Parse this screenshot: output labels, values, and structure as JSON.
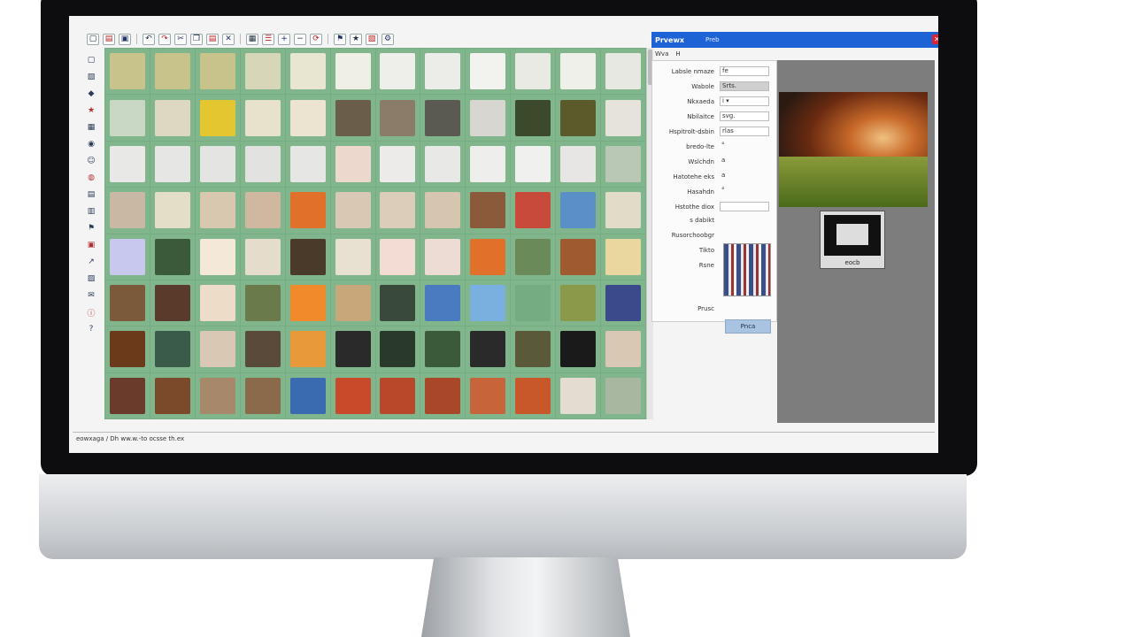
{
  "window": {
    "title": "Prvewx",
    "title_secondary": "Preb",
    "close_icon": "close-icon",
    "tabs": [
      "Wva",
      "H"
    ]
  },
  "toolbar": {
    "buttons": [
      {
        "icon": "new-icon",
        "glyph": "▢"
      },
      {
        "icon": "open-icon",
        "glyph": "▤"
      },
      {
        "icon": "save-icon",
        "glyph": "▣"
      },
      {
        "icon": "undo-icon",
        "glyph": "↶"
      },
      {
        "icon": "redo-icon",
        "glyph": "↷"
      },
      {
        "icon": "cut-icon",
        "glyph": "✂"
      },
      {
        "icon": "copy-icon",
        "glyph": "❐"
      },
      {
        "icon": "paste-icon",
        "glyph": "▤"
      },
      {
        "icon": "delete-icon",
        "glyph": "✕"
      },
      {
        "icon": "grid-icon",
        "glyph": "▦"
      },
      {
        "icon": "list-icon",
        "glyph": "☰"
      },
      {
        "icon": "zoom-in-icon",
        "glyph": "+"
      },
      {
        "icon": "zoom-out-icon",
        "glyph": "−"
      },
      {
        "icon": "rotate-icon",
        "glyph": "⟳"
      },
      {
        "icon": "flag-icon",
        "glyph": "⚑"
      },
      {
        "icon": "star-icon",
        "glyph": "★"
      },
      {
        "icon": "image-icon",
        "glyph": "▧"
      },
      {
        "icon": "settings-icon",
        "glyph": "⚙"
      }
    ]
  },
  "left_rail": {
    "icons": [
      "folder-icon",
      "image-icon",
      "tag-icon",
      "star-icon",
      "calendar-icon",
      "camera-icon",
      "person-icon",
      "map-icon",
      "album-icon",
      "trash-icon",
      "flag-icon",
      "lock-icon",
      "share-icon",
      "print-icon",
      "mail-icon",
      "info-icon",
      "help-icon"
    ]
  },
  "thumbnails": {
    "colors": [
      "#c8c38a",
      "#c8c38a",
      "#c8c38a",
      "#d8d6b8",
      "#e8e6d0",
      "#f0efe6",
      "#eeeeea",
      "#ecece8",
      "#f2f2ee",
      "#eaeae4",
      "#f0f0ea",
      "#e8e8e2",
      "#c8d8c4",
      "#ddd8c2",
      "#e3c630",
      "#e8e2cc",
      "#ece4d0",
      "#6a5e4a",
      "#8a7c68",
      "#5a5a52",
      "#d8d6d0",
      "#3a4a2a",
      "#5a5a2a",
      "#e6e4da",
      "#e8e8e6",
      "#e6e6e4",
      "#e4e4e2",
      "#e2e2e0",
      "#e6e6e4",
      "#ecd8cc",
      "#ecebea",
      "#e8e8e6",
      "#eeeeec",
      "#f0f0ee",
      "#e8e6e4",
      "#b8c8b4",
      "#c8b8a4",
      "#e4ddc8",
      "#d8c8b0",
      "#d0b8a0",
      "#e0702a",
      "#d8c8b4",
      "#dcccba",
      "#d6c6b0",
      "#8a5a3a",
      "#c84a3a",
      "#5a90c8",
      "#e0dcc8",
      "#c8c8ee",
      "#3a5a3a",
      "#f4e8d8",
      "#e6dccc",
      "#4a3a2a",
      "#e8e0d0",
      "#f2dcd4",
      "#ecdcd4",
      "#e0702a",
      "#6a8a5a",
      "#a05a30",
      "#e8d8a0",
      "#7a5a3a",
      "#5a3a2a",
      "#ecdcc8",
      "#6a7a4a",
      "#f08a2a",
      "#c8a87a",
      "#3a4a3a",
      "#4a7ac0",
      "#7ab0e0",
      "#76ac82",
      "#8a9a4a",
      "#3a4a8a",
      "#6a3a1a",
      "#3a5a4a",
      "#d8c8b4",
      "#5a4a3a",
      "#e89a3a",
      "#2a2a2a",
      "#2a3a2a",
      "#3a5a3a",
      "#2a2a2a",
      "#5a5a3a",
      "#1a1a1a",
      "#d8c8b4",
      "#6a3a2a",
      "#7a4a2a",
      "#a8886a",
      "#8a6a4a",
      "#3a6ab0",
      "#c84a2a",
      "#b8482a",
      "#a84828",
      "#c8643a",
      "#c8582a",
      "#e4dcd0",
      "#a8b8a0"
    ]
  },
  "properties": {
    "rows": [
      {
        "label": "Labsle nmaze",
        "value": "fe",
        "style": "field"
      },
      {
        "label": "Wabole",
        "value": "Srts.",
        "style": "gray"
      },
      {
        "label": "Nkxaeda",
        "value": "i ▾",
        "style": "field"
      },
      {
        "label": "Nbilaitce",
        "value": "svg.",
        "style": "field"
      },
      {
        "label": "Hspitrolt-dsbin",
        "value": "rlas",
        "style": "field"
      },
      {
        "label": "bredo-lte",
        "value": "°",
        "style": "bare"
      },
      {
        "label": "Wslchdn",
        "value": "a",
        "style": "bare"
      },
      {
        "label": "Hatotehe eks",
        "value": "a",
        "style": "bare"
      },
      {
        "label": "Hasahdn",
        "value": "°",
        "style": "bare"
      },
      {
        "label": "Hstothe diox",
        "value": "",
        "style": "field"
      },
      {
        "label": "s dabikt",
        "value": "",
        "style": "bare"
      },
      {
        "label": "Rusorchoobgr",
        "value": "",
        "style": "bare"
      },
      {
        "label": "Tikto",
        "value": "",
        "style": "bare"
      },
      {
        "label": "Rsne",
        "value": "",
        "style": "bare"
      }
    ],
    "footer_label": "Prusc",
    "apply_label": "Pnca"
  },
  "preview": {
    "thumb_caption": "eocb"
  },
  "status": {
    "text": "eowxaga / Dh ww.w.-to ocsse th.ex"
  }
}
